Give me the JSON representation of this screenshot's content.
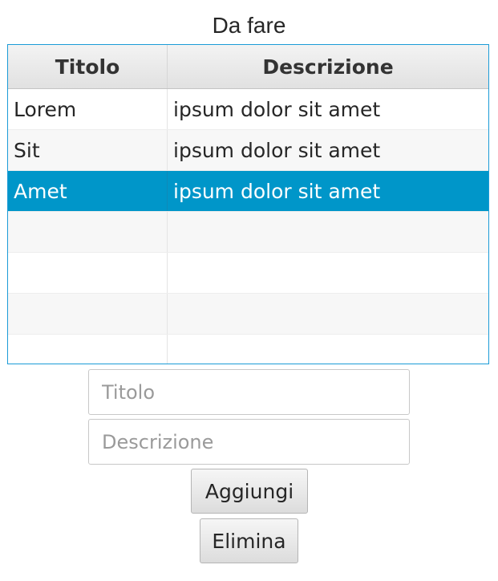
{
  "title": "Da fare",
  "table": {
    "columns": [
      "Titolo",
      "Descrizione"
    ],
    "rows": [
      {
        "titolo": "Lorem",
        "descrizione": "ipsum dolor sit amet"
      },
      {
        "titolo": "Sit",
        "descrizione": "ipsum dolor sit amet"
      },
      {
        "titolo": "Amet",
        "descrizione": "ipsum dolor sit amet"
      }
    ],
    "selected_row": 2,
    "selection_color": "#0096c9",
    "border_color": "#1b9bd7"
  },
  "form": {
    "titolo_placeholder": "Titolo",
    "titolo_value": "",
    "descrizione_placeholder": "Descrizione",
    "descrizione_value": ""
  },
  "buttons": {
    "add_label": "Aggiungi",
    "delete_label": "Elimina"
  }
}
